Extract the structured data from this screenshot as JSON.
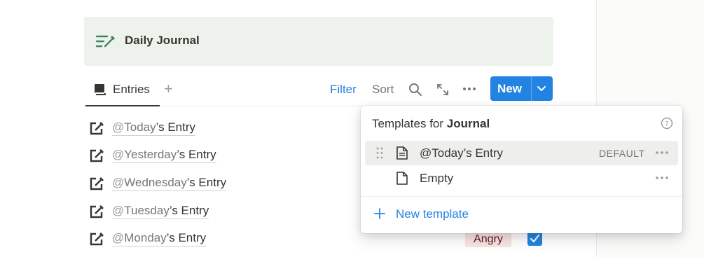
{
  "callout": {
    "title": "Daily Journal",
    "icon": "edit-list-icon"
  },
  "tabs": {
    "active_label": "Entries",
    "add_icon": "plus-icon"
  },
  "toolbar": {
    "filter_label": "Filter",
    "sort_label": "Sort",
    "new_label": "New"
  },
  "entries": [
    {
      "at": "@",
      "day": "Today",
      "suffix": "’s Entry"
    },
    {
      "at": "@",
      "day": "Yesterday",
      "suffix": "’s Entry"
    },
    {
      "at": "@",
      "day": "Wednesday",
      "suffix": "’s Entry"
    },
    {
      "at": "@",
      "day": "Tuesday",
      "suffix": "’s Entry"
    },
    {
      "at": "@",
      "day": "Monday",
      "suffix": "’s Entry"
    }
  ],
  "row_tag": {
    "label": "Angry",
    "checked": true
  },
  "popup": {
    "title_prefix": "Templates for ",
    "title_bold": "Journal",
    "items": [
      {
        "label": "@Today’s Entry",
        "badge": "DEFAULT",
        "selected": true
      },
      {
        "label": "Empty",
        "badge": "",
        "selected": false
      }
    ],
    "new_template_label": "New template"
  },
  "colors": {
    "accent": "#2383e2",
    "callout_bg": "#edf3ec",
    "tag_bg": "#fbe4e4"
  }
}
